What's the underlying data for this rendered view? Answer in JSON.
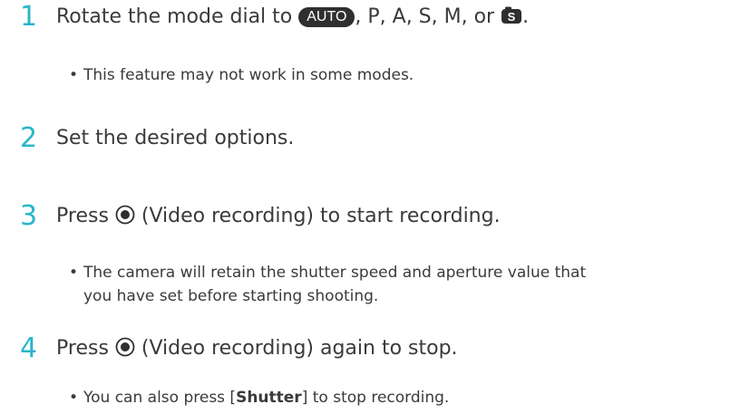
{
  "steps": [
    {
      "number": "1",
      "text_before": "Rotate the mode dial to ",
      "mode_auto": "AUTO",
      "text_mid": ", P, A, S, M, or ",
      "mode_icon_letter": "S",
      "text_after": ".",
      "bullet": "This feature may not work in some modes."
    },
    {
      "number": "2",
      "text": "Set the desired options."
    },
    {
      "number": "3",
      "text_before": "Press ",
      "text_after": " (Video recording) to start recording.",
      "bullet_line1": "The camera will retain the shutter speed and aperture value that",
      "bullet_line2": "you have set before starting shooting."
    },
    {
      "number": "4",
      "text_before": "Press ",
      "text_after": " (Video recording) again to stop.",
      "bullet_before": "You can also press [",
      "bullet_key": "Shutter",
      "bullet_after": "] to stop recording."
    }
  ],
  "bullet_char": "•",
  "icons": {
    "mode_icon": "scene-camera-icon",
    "record_icon": "video-record-icon"
  },
  "colors": {
    "step_number": "#29b6c9",
    "text": "#3a3a3a",
    "pill_bg": "#2f2f2f"
  }
}
